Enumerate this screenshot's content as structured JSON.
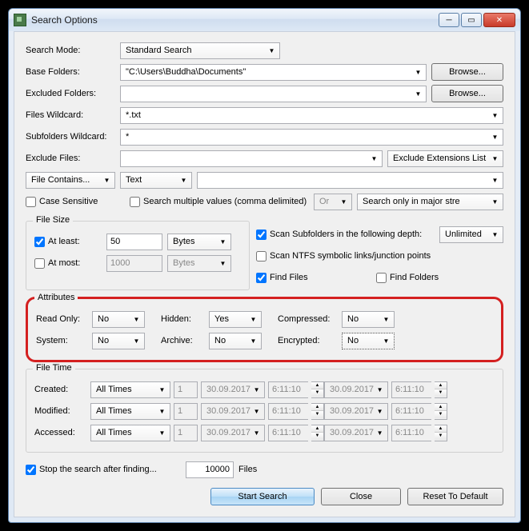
{
  "window": {
    "title": "Search Options"
  },
  "form": {
    "search_mode_label": "Search Mode:",
    "search_mode_value": "Standard Search",
    "base_folders_label": "Base Folders:",
    "base_folders_value": "\"C:\\Users\\Buddha\\Documents\"",
    "browse": "Browse...",
    "excluded_folders_label": "Excluded Folders:",
    "excluded_folders_value": "",
    "files_wildcard_label": "Files Wildcard:",
    "files_wildcard_value": "*.txt",
    "subfolders_wildcard_label": "Subfolders Wildcard:",
    "subfolders_wildcard_value": "*",
    "exclude_files_label": "Exclude Files:",
    "exclude_files_value": "",
    "exclude_ext_list": "Exclude Extensions List",
    "file_contains": "File Contains...",
    "text": "Text",
    "case_sensitive": "Case Sensitive",
    "search_multiple": "Search multiple values (comma delimited)",
    "or": "Or",
    "major_streams": "Search only in major stre"
  },
  "filesize": {
    "title": "File Size",
    "at_least": "At least:",
    "at_least_val": "50",
    "at_least_unit": "Bytes",
    "at_most": "At most:",
    "at_most_val": "1000",
    "at_most_unit": "Bytes"
  },
  "scan": {
    "subfolders": "Scan Subfolders in the following depth:",
    "unlimited": "Unlimited",
    "ntfs": "Scan NTFS symbolic links/junction points",
    "find_files": "Find Files",
    "find_folders": "Find Folders"
  },
  "attributes": {
    "title": "Attributes",
    "read_only": "Read Only:",
    "read_only_val": "No",
    "hidden": "Hidden:",
    "hidden_val": "Yes",
    "compressed": "Compressed:",
    "compressed_val": "No",
    "system": "System:",
    "system_val": "No",
    "archive": "Archive:",
    "archive_val": "No",
    "encrypted": "Encrypted:",
    "encrypted_val": "No"
  },
  "filetime": {
    "title": "File Time",
    "created": "Created:",
    "modified": "Modified:",
    "accessed": "Accessed:",
    "all_times": "All Times",
    "one": "1",
    "date": "30.09.2017",
    "time": "6:11:10"
  },
  "stop": {
    "label": "Stop the search after finding...",
    "value": "10000",
    "files": "Files"
  },
  "buttons": {
    "start": "Start Search",
    "close": "Close",
    "reset": "Reset To Default"
  }
}
